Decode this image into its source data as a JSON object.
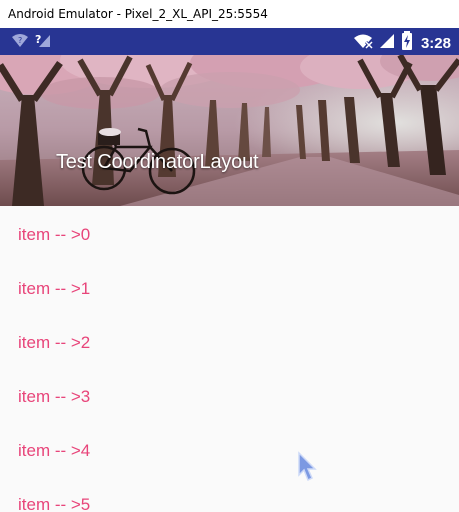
{
  "window": {
    "title": "Android Emulator - Pixel_2_XL_API_25:5554"
  },
  "status_bar": {
    "time": "3:28",
    "background": "#283593",
    "left_icons": [
      "wifi-question-icon",
      "signal-question-icon"
    ],
    "right_icons": [
      "wifi-off-icon",
      "cell-signal-icon",
      "battery-charging-icon"
    ]
  },
  "header": {
    "title": "Test CoordinatorLayout",
    "image": "tree-lined-path-bicycle-image"
  },
  "list": {
    "text_color": "#e8457a",
    "items": [
      {
        "label": "item -- >0"
      },
      {
        "label": "item -- >1"
      },
      {
        "label": "item -- >2"
      },
      {
        "label": "item -- >3"
      },
      {
        "label": "item -- >4"
      },
      {
        "label": "item -- >5"
      }
    ]
  }
}
